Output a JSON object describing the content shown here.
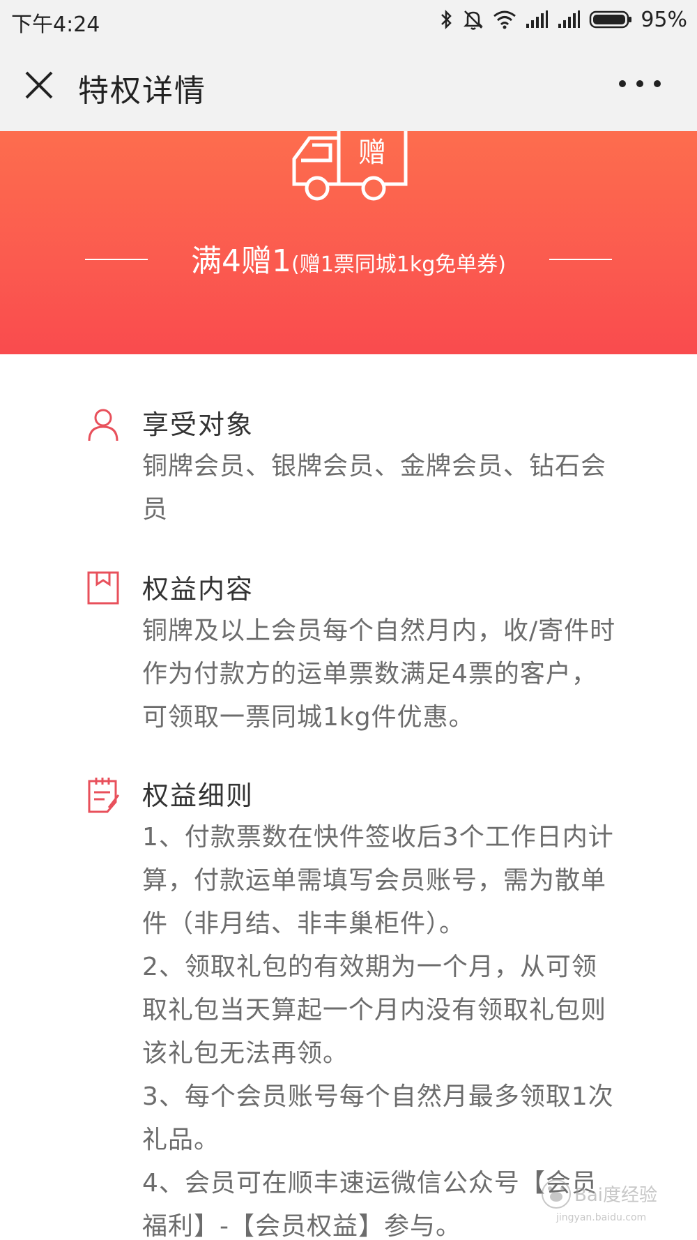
{
  "status_bar": {
    "time": "下午4:24",
    "battery": "95%",
    "icons": [
      "bluetooth-icon",
      "mute-icon",
      "wifi-icon",
      "signal-icon",
      "signal-icon",
      "battery-icon"
    ]
  },
  "header": {
    "title": "特权详情",
    "close_icon": "close-icon",
    "more_icon": "more-icon"
  },
  "banner": {
    "badge_text": "赠",
    "headline": "满4赠1",
    "subline": "(赠1票同城1kg免单券)",
    "colors": {
      "top": "#fd6d4e",
      "bottom": "#f94b4e"
    }
  },
  "sections": [
    {
      "icon": "person-icon",
      "title": "享受对象",
      "lines": [
        "铜牌会员、银牌会员、金牌会员、钻石会员"
      ]
    },
    {
      "icon": "box-icon",
      "title": "权益内容",
      "lines": [
        "铜牌及以上会员每个自然月内，收/寄件时作为付款方的运单票数满足4票的客户，可领取一票同城1kg件优惠。"
      ]
    },
    {
      "icon": "notepad-icon",
      "title": "权益细则",
      "lines": [
        "1、付款票数在快件签收后3个工作日内计算，付款运单需填写会员账号，需为散单件（非月结、非丰巢柜件）。",
        "2、领取礼包的有效期为一个月，从可领取礼包当天算起一个月内没有领取礼包则该礼包无法再领。",
        "3、每个会员账号每个自然月最多领取1次礼品。",
        "4、会员可在顺丰速运微信公众号【会员福利】-【会员权益】参与。"
      ]
    }
  ],
  "watermark": {
    "brand": "Bai度经验",
    "url": "jingyan.baidu.com"
  },
  "accent_color": "#e8505b"
}
